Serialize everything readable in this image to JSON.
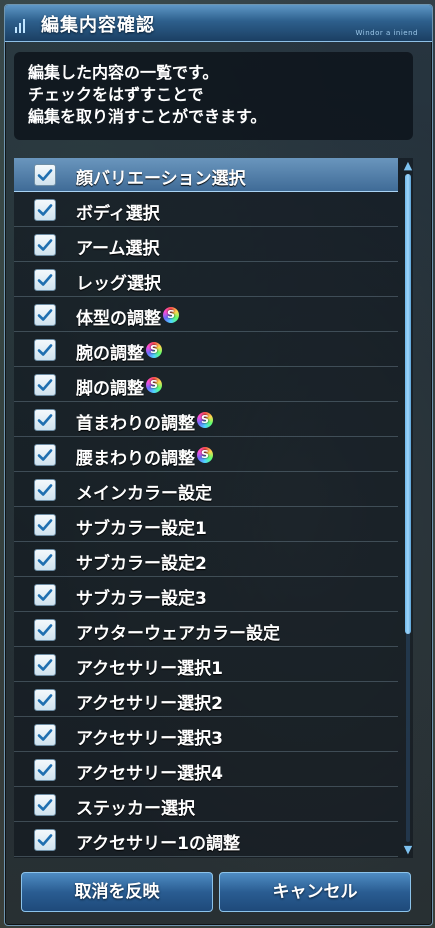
{
  "window": {
    "title": "編集内容確認",
    "tag": "Windor a iniend"
  },
  "message": {
    "lines": [
      "編集した内容の一覧です。",
      "チェックをはずすことで",
      "編集を取り消すことができます。"
    ]
  },
  "items": [
    {
      "label": "顔バリエーション選択",
      "checked": true,
      "s_icon": false,
      "selected": true
    },
    {
      "label": "ボディ選択",
      "checked": true,
      "s_icon": false,
      "selected": false
    },
    {
      "label": "アーム選択",
      "checked": true,
      "s_icon": false,
      "selected": false
    },
    {
      "label": "レッグ選択",
      "checked": true,
      "s_icon": false,
      "selected": false
    },
    {
      "label": "体型の調整",
      "checked": true,
      "s_icon": true,
      "selected": false
    },
    {
      "label": "腕の調整",
      "checked": true,
      "s_icon": true,
      "selected": false
    },
    {
      "label": "脚の調整",
      "checked": true,
      "s_icon": true,
      "selected": false
    },
    {
      "label": "首まわりの調整",
      "checked": true,
      "s_icon": true,
      "selected": false
    },
    {
      "label": "腰まわりの調整",
      "checked": true,
      "s_icon": true,
      "selected": false
    },
    {
      "label": "メインカラー設定",
      "checked": true,
      "s_icon": false,
      "selected": false
    },
    {
      "label": "サブカラー設定1",
      "checked": true,
      "s_icon": false,
      "selected": false
    },
    {
      "label": "サブカラー設定2",
      "checked": true,
      "s_icon": false,
      "selected": false
    },
    {
      "label": "サブカラー設定3",
      "checked": true,
      "s_icon": false,
      "selected": false
    },
    {
      "label": "アウターウェアカラー設定",
      "checked": true,
      "s_icon": false,
      "selected": false
    },
    {
      "label": "アクセサリー選択1",
      "checked": true,
      "s_icon": false,
      "selected": false
    },
    {
      "label": "アクセサリー選択2",
      "checked": true,
      "s_icon": false,
      "selected": false
    },
    {
      "label": "アクセサリー選択3",
      "checked": true,
      "s_icon": false,
      "selected": false
    },
    {
      "label": "アクセサリー選択4",
      "checked": true,
      "s_icon": false,
      "selected": false
    },
    {
      "label": "ステッカー選択",
      "checked": true,
      "s_icon": false,
      "selected": false
    },
    {
      "label": "アクセサリー1の調整",
      "checked": true,
      "s_icon": false,
      "selected": false
    }
  ],
  "buttons": {
    "apply_label": "取消を反映",
    "cancel_label": "キャンセル"
  },
  "colors": {
    "accent": "#2d5f8c",
    "checkmark": "#1f6fb0",
    "selected_row": "#6fa8d8"
  },
  "icons": {
    "check": "checkmark-icon",
    "special": "rainbow-s-icon",
    "scroll_up": "chevron-up-icon",
    "scroll_down": "chevron-down-icon"
  }
}
